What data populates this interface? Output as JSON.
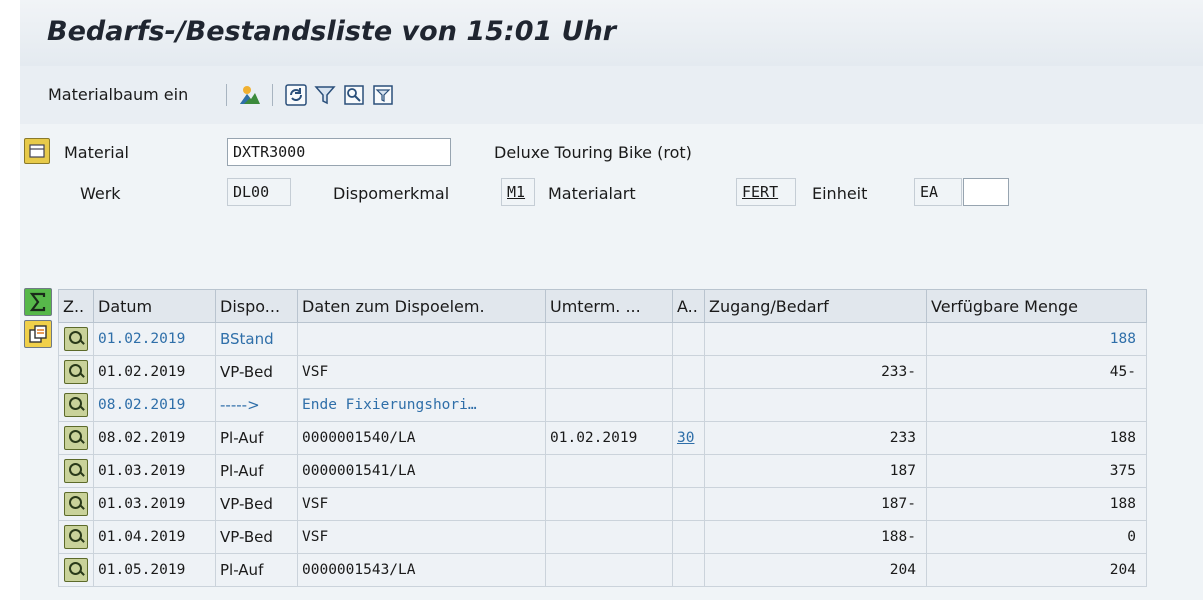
{
  "window": {
    "title": "Bedarfs-/Bestandsliste von 15:01 Uhr"
  },
  "toolbar": {
    "material_tree_label": "Materialbaum ein",
    "icons": [
      "mountain-icon",
      "refresh-icon",
      "filter-icon",
      "find-icon",
      "filter-settings-icon"
    ]
  },
  "header": {
    "material_label": "Material",
    "material_value": "DXTR3000",
    "material_desc": "Deluxe Touring Bike (rot)",
    "plant_label": "Werk",
    "plant_value": "DL00",
    "mrp_label": "Dispomerkmal",
    "mrp_value": "M1",
    "mattype_label": "Materialart",
    "mattype_value": "FERT",
    "unit_label": "Einheit",
    "unit_value": "EA",
    "unit_extra": ""
  },
  "grid": {
    "columns": [
      "Z..",
      "Datum",
      "Dispo...",
      "Daten zum Dispoelem.",
      "Umterm. ...",
      "A..",
      "Zugang/Bedarf",
      "Verfügbare Menge"
    ],
    "rows": [
      {
        "date": "01.02.2019",
        "mrp": "BStand",
        "data": "",
        "resched": "",
        "a": "",
        "receipt": "",
        "available": "188",
        "blue": true
      },
      {
        "date": "01.02.2019",
        "mrp": "VP-Bed",
        "data": "VSF",
        "resched": "",
        "a": "",
        "receipt": "233-",
        "available": "45-",
        "blue": false
      },
      {
        "date": "08.02.2019",
        "mrp": "----->",
        "data": "Ende Fixierungshori…",
        "resched": "",
        "a": "",
        "receipt": "",
        "available": "",
        "blue": true
      },
      {
        "date": "08.02.2019",
        "mrp": "Pl-Auf",
        "data": "0000001540/LA",
        "resched": "01.02.2019",
        "a": "30",
        "receipt": "233",
        "available": "188",
        "blue": false
      },
      {
        "date": "01.03.2019",
        "mrp": "Pl-Auf",
        "data": "0000001541/LA",
        "resched": "",
        "a": "",
        "receipt": "187",
        "available": "375",
        "blue": false
      },
      {
        "date": "01.03.2019",
        "mrp": "VP-Bed",
        "data": "VSF",
        "resched": "",
        "a": "",
        "receipt": "187-",
        "available": "188",
        "blue": false
      },
      {
        "date": "01.04.2019",
        "mrp": "VP-Bed",
        "data": "VSF",
        "resched": "",
        "a": "",
        "receipt": "188-",
        "available": "0",
        "blue": false
      },
      {
        "date": "01.05.2019",
        "mrp": "Pl-Auf",
        "data": "0000001543/LA",
        "resched": "",
        "a": "",
        "receipt": "204",
        "available": "204",
        "blue": false
      }
    ]
  },
  "colors": {
    "link": "#2f6fa9",
    "header_bg": "#e1e7ed",
    "area_bg": "#f0f4f7"
  }
}
